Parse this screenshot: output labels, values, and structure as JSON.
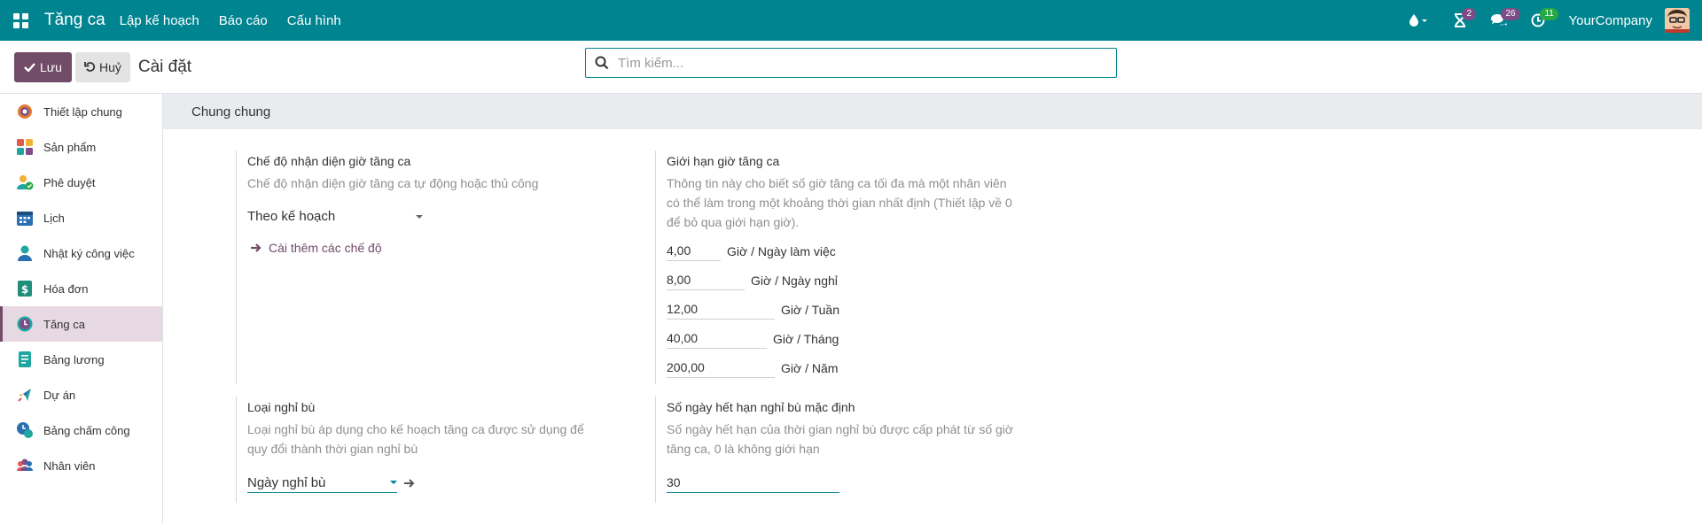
{
  "navbar": {
    "app_name": "Tăng ca",
    "menu": [
      "Lập kế hoạch",
      "Báo cáo",
      "Cấu hình"
    ],
    "activity_badge": "2",
    "messages_badge": "26",
    "timer_badge": "11",
    "company": "YourCompany",
    "colors": {
      "bg": "#00848f",
      "badge": "#7c4d86",
      "green": "#28a745"
    }
  },
  "control": {
    "save_label": "Lưu",
    "cancel_label": "Huỷ",
    "title": "Cài đặt",
    "search_placeholder": "Tìm kiếm..."
  },
  "sidebar": {
    "items": [
      {
        "label": "Thiết lập chung",
        "icon": "general-settings-icon",
        "active": false
      },
      {
        "label": "Sản phẩm",
        "icon": "product-icon",
        "active": false
      },
      {
        "label": "Phê duyệt",
        "icon": "approval-icon",
        "active": false
      },
      {
        "label": "Lịch",
        "icon": "calendar-icon",
        "active": false
      },
      {
        "label": "Nhật ký công việc",
        "icon": "work-log-icon",
        "active": false
      },
      {
        "label": "Hóa đơn",
        "icon": "invoice-icon",
        "active": false
      },
      {
        "label": "Tăng ca",
        "icon": "overtime-icon",
        "active": true
      },
      {
        "label": "Bảng lương",
        "icon": "payroll-icon",
        "active": false
      },
      {
        "label": "Dự án",
        "icon": "project-icon",
        "active": false
      },
      {
        "label": "Bảng chấm công",
        "icon": "timesheet-icon",
        "active": false
      },
      {
        "label": "Nhân viên",
        "icon": "employee-icon",
        "active": false
      }
    ]
  },
  "main": {
    "section_title": "Chung chung",
    "recognition": {
      "title": "Chế độ nhận diện giờ tăng ca",
      "desc": "Chế độ nhận diện giờ tăng ca tự động hoặc thủ công",
      "value": "Theo kế hoạch",
      "link": "Cài thêm các chế độ"
    },
    "limit": {
      "title": "Giới hạn giờ tăng ca",
      "desc": "Thông tin này cho biết số giờ tăng ca tối đa mà một nhân viên có thể làm trong một khoảng thời gian nhất định (Thiết lập về 0 để bỏ qua giới hạn giờ).",
      "rows": [
        {
          "value": "4,00",
          "unit": "Giờ / Ngày làm việc"
        },
        {
          "value": "8,00",
          "unit": "Giờ / Ngày nghỉ"
        },
        {
          "value": "12,00",
          "unit": "Giờ / Tuần"
        },
        {
          "value": "40,00",
          "unit": "Giờ / Tháng"
        },
        {
          "value": "200,00",
          "unit": "Giờ / Năm"
        }
      ]
    },
    "leave_type": {
      "title": "Loại nghỉ bù",
      "desc": "Loại nghỉ bù áp dụng cho kế hoạch tăng ca được sử dụng để quy đổi thành thời gian nghỉ bù",
      "value": "Ngày nghỉ bù"
    },
    "expiry": {
      "title": "Số ngày hết hạn nghỉ bù mặc định",
      "desc": "Số ngày hết hạn của thời gian nghỉ bù được cấp phát từ số giờ tăng ca, 0 là không giới hạn",
      "value": "30"
    }
  }
}
